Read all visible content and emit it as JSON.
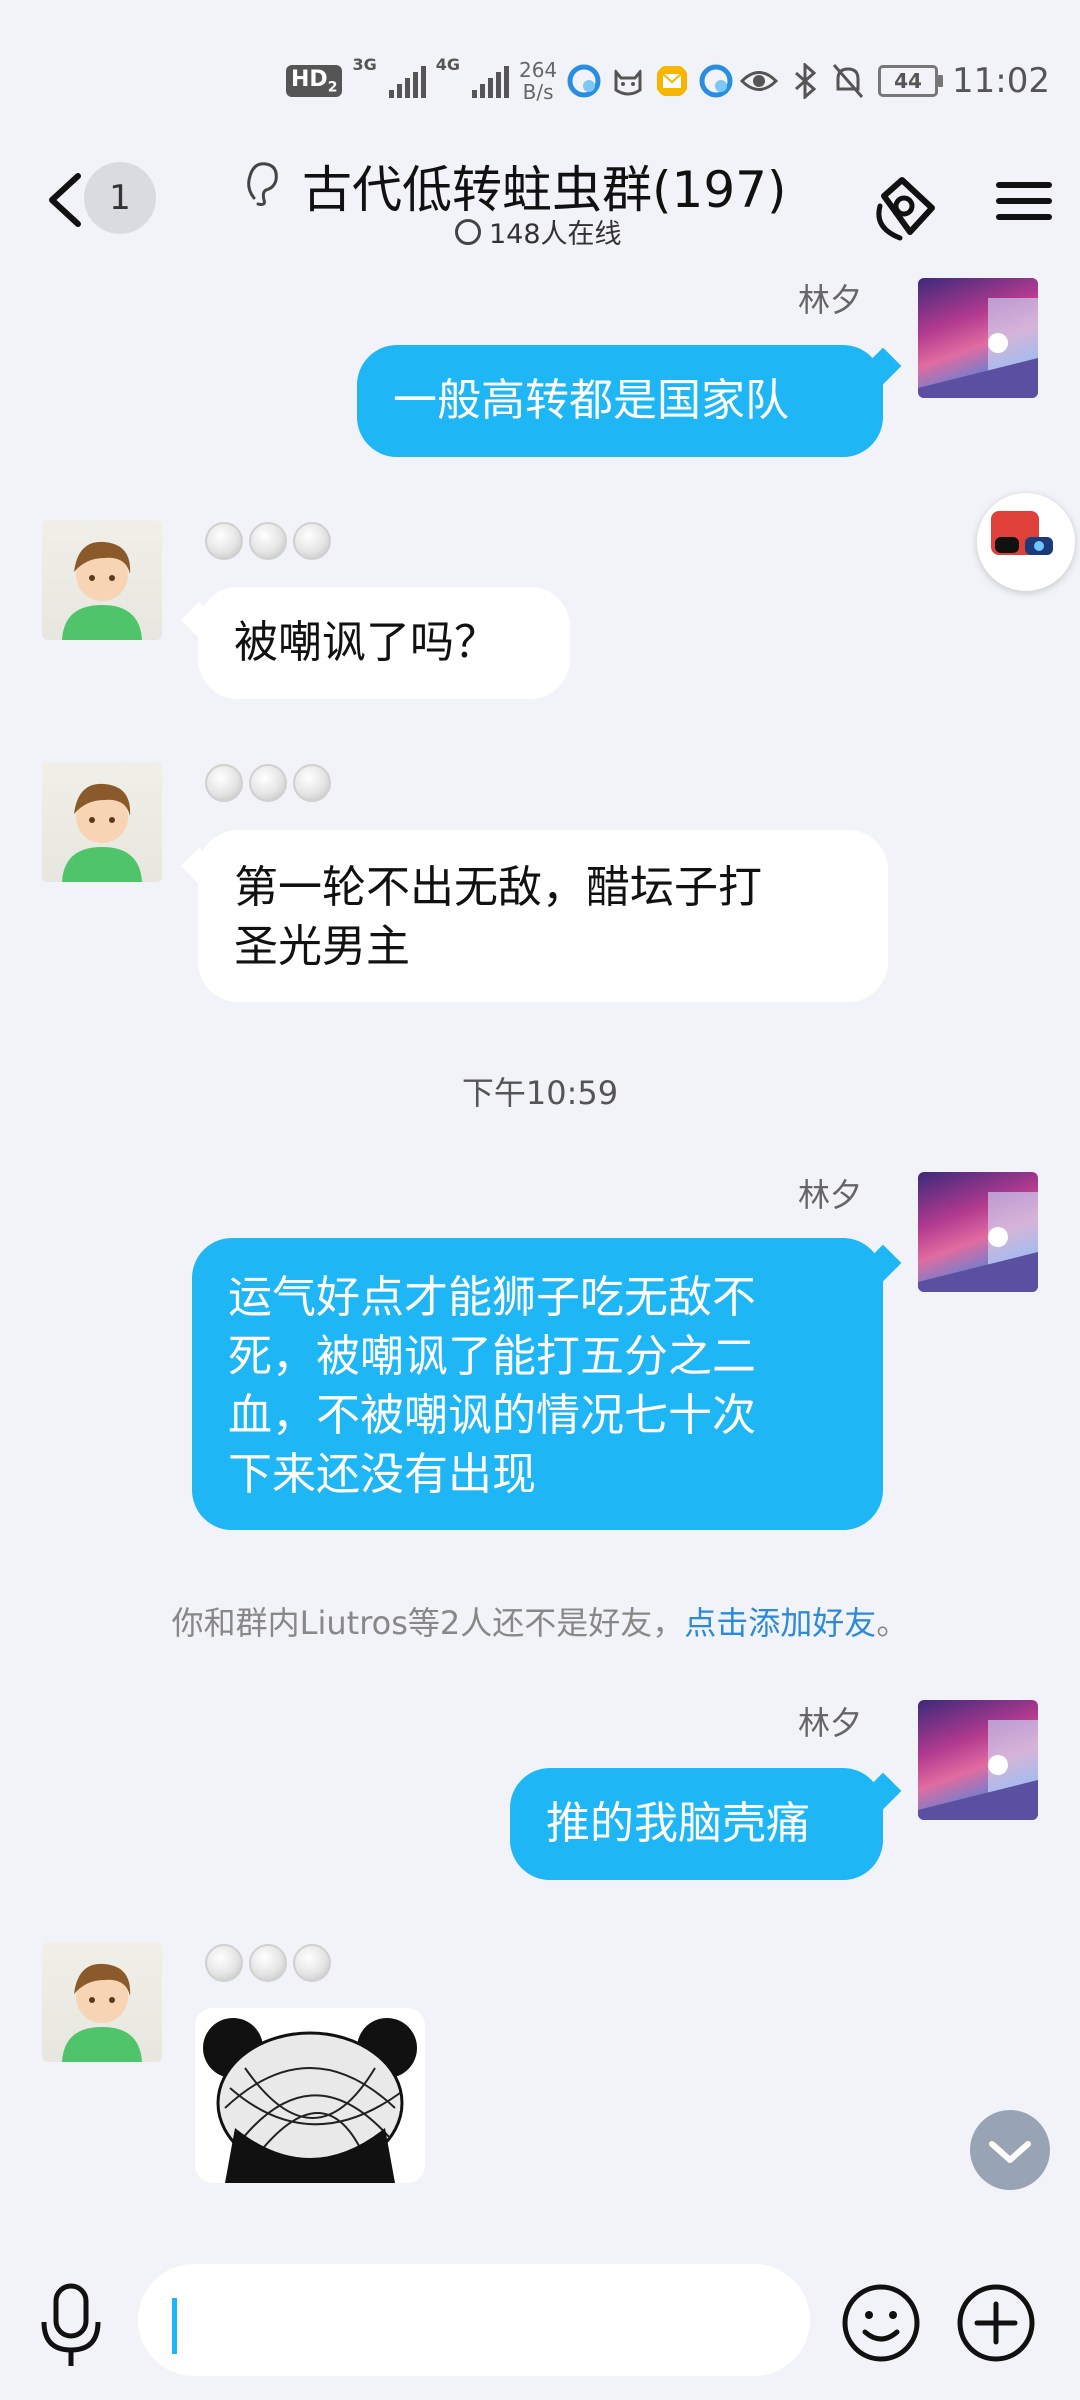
{
  "status_bar": {
    "hd_label": "HD",
    "hd_sub": "2",
    "net1": "3G",
    "net2": "4G",
    "speed_value": "264",
    "speed_unit": "B/s",
    "battery": "44",
    "time": "11:02",
    "icons": [
      "edge-icon",
      "cat-icon",
      "mail-icon",
      "edge-icon",
      "eye-icon",
      "bluetooth-icon",
      "bell-off-icon"
    ]
  },
  "header": {
    "back_count": "1",
    "title": "古代低转蛀虫群(197)",
    "online": "148人在线"
  },
  "messages": [
    {
      "side": "me",
      "sender": "林夕",
      "text": "一般高转都是国家队"
    },
    {
      "side": "other",
      "text": "被嘲讽了吗？"
    },
    {
      "side": "other",
      "text": "第一轮不出无敌，醋坛子打\n圣光男主"
    },
    {
      "side": "me",
      "sender": "林夕",
      "text": "运气好点才能狮子吃无敌不\n死，被嘲讽了能打五分之二\n血，不被嘲讽的情况七十次\n下来还没有出现"
    },
    {
      "side": "me",
      "sender": "林夕",
      "text": "推的我脑壳痛"
    },
    {
      "side": "other",
      "type": "sticker",
      "sticker": "panda-meme-sticker"
    }
  ],
  "timestamp": "下午10:59",
  "system_note": {
    "text": "你和群内Liutros等2人还不是好友，",
    "link": "点击添加好友",
    "end": "。"
  },
  "colors": {
    "accent": "#1eb6f5",
    "background": "#f2f3f8",
    "link": "#2c8ad8"
  }
}
